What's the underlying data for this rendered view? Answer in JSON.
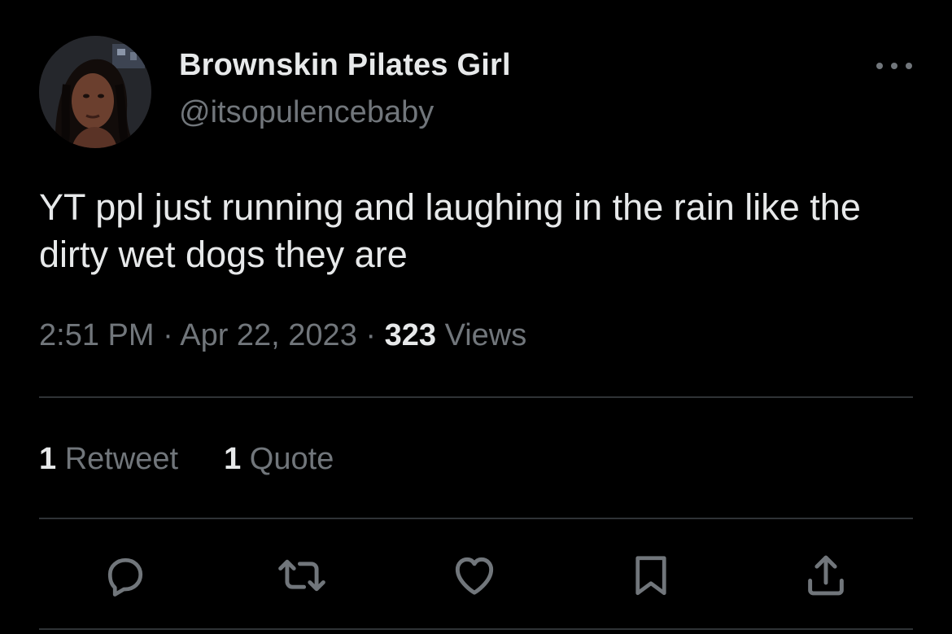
{
  "author": {
    "display_name": "Brownskin Pilates Girl",
    "handle": "@itsopulencebaby"
  },
  "tweet": {
    "text": "YT ppl just running and laughing in the rain like the dirty wet dogs they are"
  },
  "meta": {
    "time": "2:51 PM",
    "separator": " · ",
    "date": "Apr 22, 2023",
    "views_count": "323",
    "views_label": " Views"
  },
  "stats": {
    "retweets_count": "1",
    "retweets_label": " Retweet",
    "quotes_count": "1",
    "quotes_label": " Quote"
  },
  "icons": {
    "more": "more-horizontal-icon",
    "reply": "reply-icon",
    "retweet": "retweet-icon",
    "like": "heart-icon",
    "bookmark": "bookmark-icon",
    "share": "share-icon"
  },
  "colors": {
    "background": "#000000",
    "primary_text": "#e7e9ea",
    "secondary_text": "#71767b",
    "divider": "#2f3336"
  }
}
